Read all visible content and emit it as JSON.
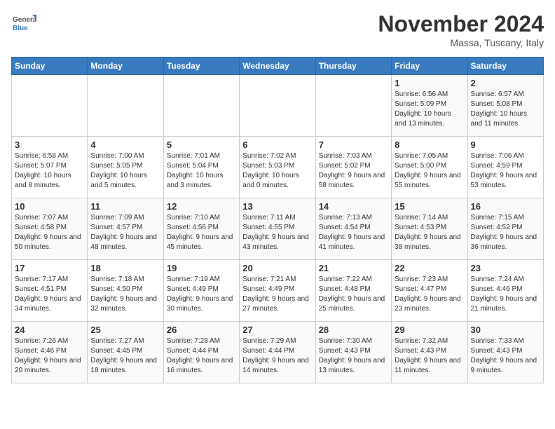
{
  "header": {
    "logo_line1": "General",
    "logo_line2": "Blue",
    "month": "November 2024",
    "location": "Massa, Tuscany, Italy"
  },
  "weekdays": [
    "Sunday",
    "Monday",
    "Tuesday",
    "Wednesday",
    "Thursday",
    "Friday",
    "Saturday"
  ],
  "weeks": [
    [
      {
        "day": "",
        "info": ""
      },
      {
        "day": "",
        "info": ""
      },
      {
        "day": "",
        "info": ""
      },
      {
        "day": "",
        "info": ""
      },
      {
        "day": "",
        "info": ""
      },
      {
        "day": "1",
        "info": "Sunrise: 6:56 AM\nSunset: 5:09 PM\nDaylight: 10 hours and 13 minutes."
      },
      {
        "day": "2",
        "info": "Sunrise: 6:57 AM\nSunset: 5:08 PM\nDaylight: 10 hours and 11 minutes."
      }
    ],
    [
      {
        "day": "3",
        "info": "Sunrise: 6:58 AM\nSunset: 5:07 PM\nDaylight: 10 hours and 8 minutes."
      },
      {
        "day": "4",
        "info": "Sunrise: 7:00 AM\nSunset: 5:05 PM\nDaylight: 10 hours and 5 minutes."
      },
      {
        "day": "5",
        "info": "Sunrise: 7:01 AM\nSunset: 5:04 PM\nDaylight: 10 hours and 3 minutes."
      },
      {
        "day": "6",
        "info": "Sunrise: 7:02 AM\nSunset: 5:03 PM\nDaylight: 10 hours and 0 minutes."
      },
      {
        "day": "7",
        "info": "Sunrise: 7:03 AM\nSunset: 5:02 PM\nDaylight: 9 hours and 58 minutes."
      },
      {
        "day": "8",
        "info": "Sunrise: 7:05 AM\nSunset: 5:00 PM\nDaylight: 9 hours and 55 minutes."
      },
      {
        "day": "9",
        "info": "Sunrise: 7:06 AM\nSunset: 4:59 PM\nDaylight: 9 hours and 53 minutes."
      }
    ],
    [
      {
        "day": "10",
        "info": "Sunrise: 7:07 AM\nSunset: 4:58 PM\nDaylight: 9 hours and 50 minutes."
      },
      {
        "day": "11",
        "info": "Sunrise: 7:09 AM\nSunset: 4:57 PM\nDaylight: 9 hours and 48 minutes."
      },
      {
        "day": "12",
        "info": "Sunrise: 7:10 AM\nSunset: 4:56 PM\nDaylight: 9 hours and 45 minutes."
      },
      {
        "day": "13",
        "info": "Sunrise: 7:11 AM\nSunset: 4:55 PM\nDaylight: 9 hours and 43 minutes."
      },
      {
        "day": "14",
        "info": "Sunrise: 7:13 AM\nSunset: 4:54 PM\nDaylight: 9 hours and 41 minutes."
      },
      {
        "day": "15",
        "info": "Sunrise: 7:14 AM\nSunset: 4:53 PM\nDaylight: 9 hours and 38 minutes."
      },
      {
        "day": "16",
        "info": "Sunrise: 7:15 AM\nSunset: 4:52 PM\nDaylight: 9 hours and 36 minutes."
      }
    ],
    [
      {
        "day": "17",
        "info": "Sunrise: 7:17 AM\nSunset: 4:51 PM\nDaylight: 9 hours and 34 minutes."
      },
      {
        "day": "18",
        "info": "Sunrise: 7:18 AM\nSunset: 4:50 PM\nDaylight: 9 hours and 32 minutes."
      },
      {
        "day": "19",
        "info": "Sunrise: 7:19 AM\nSunset: 4:49 PM\nDaylight: 9 hours and 30 minutes."
      },
      {
        "day": "20",
        "info": "Sunrise: 7:21 AM\nSunset: 4:49 PM\nDaylight: 9 hours and 27 minutes."
      },
      {
        "day": "21",
        "info": "Sunrise: 7:22 AM\nSunset: 4:48 PM\nDaylight: 9 hours and 25 minutes."
      },
      {
        "day": "22",
        "info": "Sunrise: 7:23 AM\nSunset: 4:47 PM\nDaylight: 9 hours and 23 minutes."
      },
      {
        "day": "23",
        "info": "Sunrise: 7:24 AM\nSunset: 4:46 PM\nDaylight: 9 hours and 21 minutes."
      }
    ],
    [
      {
        "day": "24",
        "info": "Sunrise: 7:26 AM\nSunset: 4:46 PM\nDaylight: 9 hours and 20 minutes."
      },
      {
        "day": "25",
        "info": "Sunrise: 7:27 AM\nSunset: 4:45 PM\nDaylight: 9 hours and 18 minutes."
      },
      {
        "day": "26",
        "info": "Sunrise: 7:28 AM\nSunset: 4:44 PM\nDaylight: 9 hours and 16 minutes."
      },
      {
        "day": "27",
        "info": "Sunrise: 7:29 AM\nSunset: 4:44 PM\nDaylight: 9 hours and 14 minutes."
      },
      {
        "day": "28",
        "info": "Sunrise: 7:30 AM\nSunset: 4:43 PM\nDaylight: 9 hours and 13 minutes."
      },
      {
        "day": "29",
        "info": "Sunrise: 7:32 AM\nSunset: 4:43 PM\nDaylight: 9 hours and 11 minutes."
      },
      {
        "day": "30",
        "info": "Sunrise: 7:33 AM\nSunset: 4:43 PM\nDaylight: 9 hours and 9 minutes."
      }
    ]
  ]
}
